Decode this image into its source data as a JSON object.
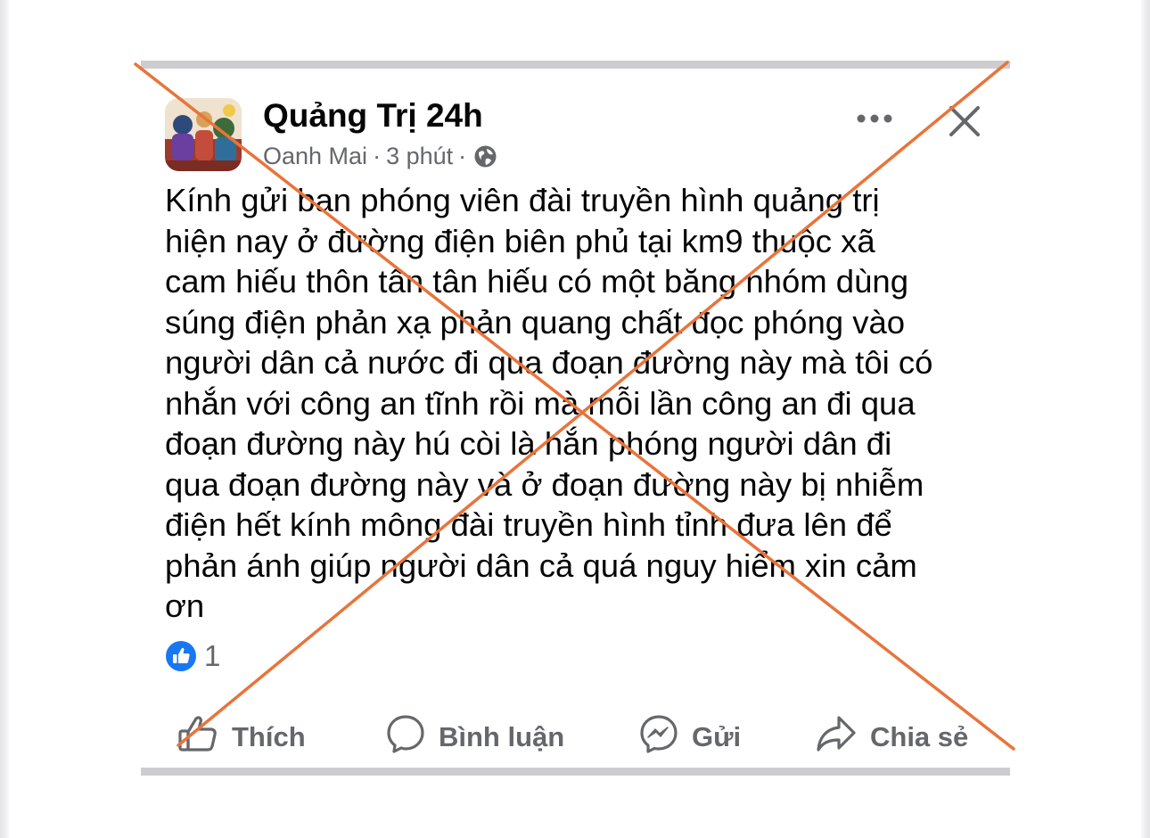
{
  "post": {
    "page_name": "Quảng Trị 24h",
    "author": "Oanh Mai",
    "separator": "·",
    "time": "3 phút",
    "body_lines": [
      "Kính gửi ban phóng viên đài truyền hình quảng trị",
      "hiện nay ở đường điện  biên phủ tại km9 thuộc xã",
      "cam hiếu thôn tân  tân hiếu có một băng nhóm dùng",
      "súng điện phản xạ phản quang chất đọc phóng vào",
      "người dân cả nước đi qua đoạn đường này mà tôi có",
      "nhắn với công an tĩnh rồi mà mỗi lần công an đi qua",
      "đoạn đường này hú còi là hắn phóng người dân đi",
      "qua đoạn đường này và ở đoạn đường này bị nhiễm",
      "điện hết kính mông đài truyền hình tỉnh đưa lên để",
      "phản ánh giúp người dân cả quá nguy hiểm xin cảm",
      "ơn"
    ],
    "reaction_count": "1",
    "actions": {
      "like": "Thích",
      "comment": "Bình luận",
      "send": "Gửi",
      "share": "Chia sẻ"
    }
  },
  "icons": {
    "audience": "globe-icon",
    "menu": "more-options-icon",
    "close": "close-icon",
    "reaction": "like-reaction-icon",
    "like": "thumbs-up-icon",
    "comment": "comment-bubble-icon",
    "send": "messenger-icon",
    "share": "share-arrow-icon"
  },
  "colors": {
    "text_primary": "#050505",
    "text_secondary": "#65676b",
    "like_blue": "#1877f2",
    "cross_mark": "#e8743b",
    "divider": "#cdcdd0"
  }
}
